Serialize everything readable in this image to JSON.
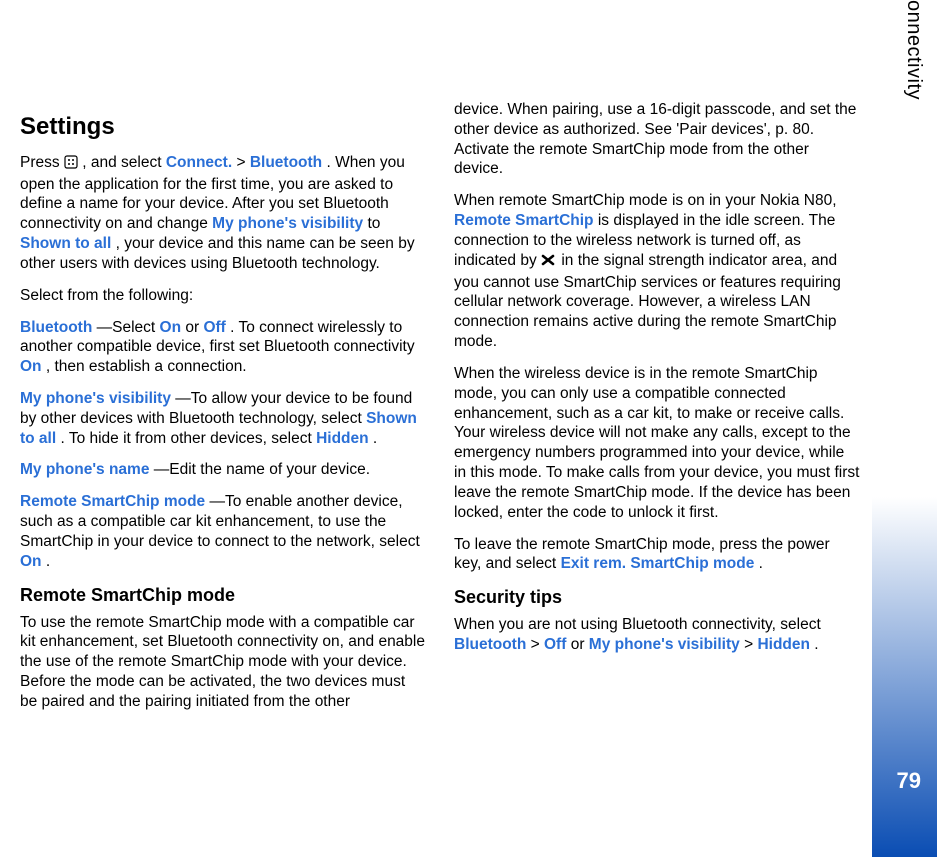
{
  "sidebar": {
    "label": "Connectivity",
    "page": "79"
  },
  "left": {
    "heading": "Settings",
    "p1a": "Press ",
    "p1b": " , and select ",
    "connect": "Connect.",
    "gt1": " > ",
    "bluetooth": "Bluetooth",
    "p1c": ". When you open the application for the first time, you are asked to define a name for your device. After you set Bluetooth connectivity on and change ",
    "mpv": "My phone's visibility",
    "p1d": " to ",
    "shown": "Shown to all",
    "p1e": ", your device and this name can be seen by other users with devices using Bluetooth technology.",
    "p2": "Select from the following:",
    "p3a": "Bluetooth",
    "p3b": "—Select ",
    "on": "On",
    "p3c": " or ",
    "off": "Off",
    "p3d": ". To connect wirelessly to another compatible device, first set Bluetooth connectivity ",
    "p3e": ", then establish a connection.",
    "p4a": "My phone's visibility",
    "p4b": "—To allow your device to be found by other devices with Bluetooth technology, select ",
    "p4c": ". To hide it from other devices, select ",
    "hidden": "Hidden",
    "p4d": ".",
    "p5a": "My phone's name",
    "p5b": "—Edit the name of your device.",
    "p6a": "Remote SmartChip mode",
    "p6b": "—To enable another device, such as a compatible car kit enhancement, to use the SmartChip in your device to connect to the network, select ",
    "p6c": ".",
    "h2": "Remote SmartChip mode",
    "p7": "To use the remote SmartChip mode with a compatible car kit enhancement, set Bluetooth connectivity on, and enable the use of the remote SmartChip mode with your device. Before the mode can be activated, the two devices must be paired and the pairing initiated from the other"
  },
  "right": {
    "p1": "device. When pairing, use a 16-digit passcode, and set the other device as authorized. See 'Pair devices', p. 80. Activate the remote SmartChip mode from the other device.",
    "p2a": "When remote SmartChip mode is on in your Nokia N80, ",
    "remotesc": "Remote SmartChip",
    "p2b": " is displayed in the idle screen. The connection to the wireless network is turned off, as indicated by ",
    "p2c": " in the signal strength indicator area, and you cannot use SmartChip services or features requiring cellular network coverage. However, a wireless LAN connection remains active during the remote SmartChip mode.",
    "p3": "When the wireless device is in the remote SmartChip mode, you can only use a compatible connected enhancement, such as a car kit, to make or receive calls. Your wireless device will not make any calls, except to the emergency numbers programmed into your device, while in this mode. To make calls from your device, you must first leave the remote SmartChip mode. If the device has been locked, enter the code to unlock it first.",
    "p4a": "To leave the remote SmartChip mode, press the power key, and select ",
    "exit": "Exit rem. SmartChip mode",
    "p4b": ".",
    "h2": "Security tips",
    "p5a": "When you are not using Bluetooth connectivity, select ",
    "p5b": " > ",
    "p5c": " or ",
    "p5d": " > ",
    "p5e": "."
  }
}
